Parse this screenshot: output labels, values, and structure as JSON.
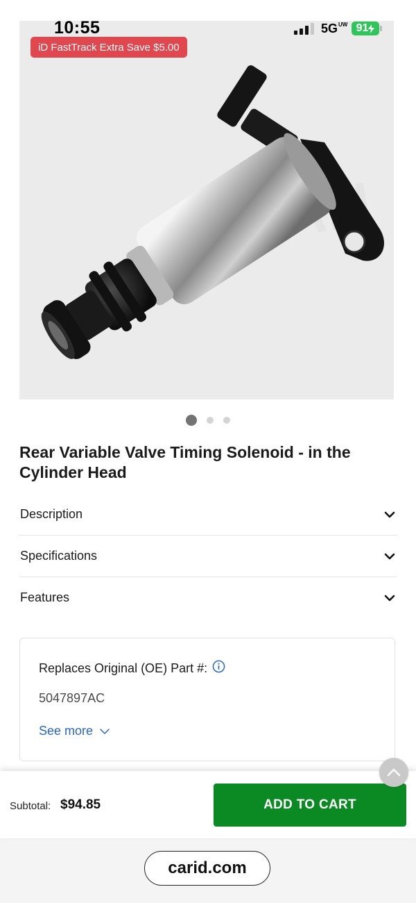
{
  "status_bar": {
    "time": "10:55",
    "network": "5G",
    "network_sup": "UW",
    "battery": "91"
  },
  "promo": {
    "badge": "iD FastTrack Extra Save $5.00"
  },
  "product": {
    "image_icon": "valve-timing-solenoid-photo",
    "title": "Rear Variable Valve Timing Solenoid - in the Cylinder Head"
  },
  "carousel": {
    "count": 3,
    "active_index": 0
  },
  "accordion": [
    {
      "label": "Description"
    },
    {
      "label": "Specifications"
    },
    {
      "label": "Features"
    }
  ],
  "oe_card": {
    "heading": "Replaces Original (OE) Part #:",
    "part_number": "5047897AC",
    "see_more": "See more"
  },
  "cart": {
    "subtotal_label": "Subtotal:",
    "subtotal_value": "$94.85",
    "add_button": "ADD TO CART"
  },
  "browser": {
    "url": "carid.com"
  },
  "colors": {
    "cta_green": "#0b8a23",
    "promo_red": "#e0474f",
    "link_blue": "#2a65c9",
    "battery_green": "#2fc55a"
  }
}
